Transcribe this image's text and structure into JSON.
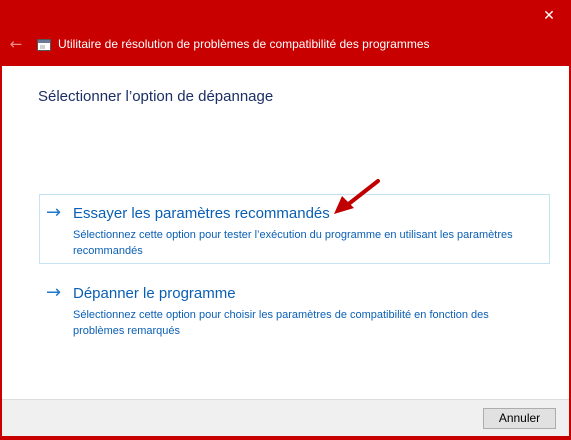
{
  "window": {
    "title": "Utilitaire de résolution de problèmes de compatibilité des programmes",
    "close_glyph": "✕",
    "back_glyph": "←"
  },
  "page": {
    "title": "Sélectionner l’option de dépannage"
  },
  "options": [
    {
      "arrow": "→",
      "title": "Essayer les paramètres recommandés",
      "description": "Sélectionnez cette option pour tester l’exécution du programme en utilisant les paramètres recommandés",
      "selected": true
    },
    {
      "arrow": "→",
      "title": "Dépanner le programme",
      "description": "Sélectionnez cette option pour choisir les paramètres de compatibilité en fonction des problèmes remarqués",
      "selected": false
    }
  ],
  "footer": {
    "cancel_label": "Annuler"
  },
  "colors": {
    "titlebar": "#c80000",
    "link": "#0a5fb4",
    "pointer": "#c00000"
  },
  "icons": {
    "close": "close-icon",
    "back": "back-arrow-icon",
    "app": "app-window-icon",
    "option_arrow": "arrow-right-icon",
    "pointer": "red-arrow-annotation-icon"
  }
}
